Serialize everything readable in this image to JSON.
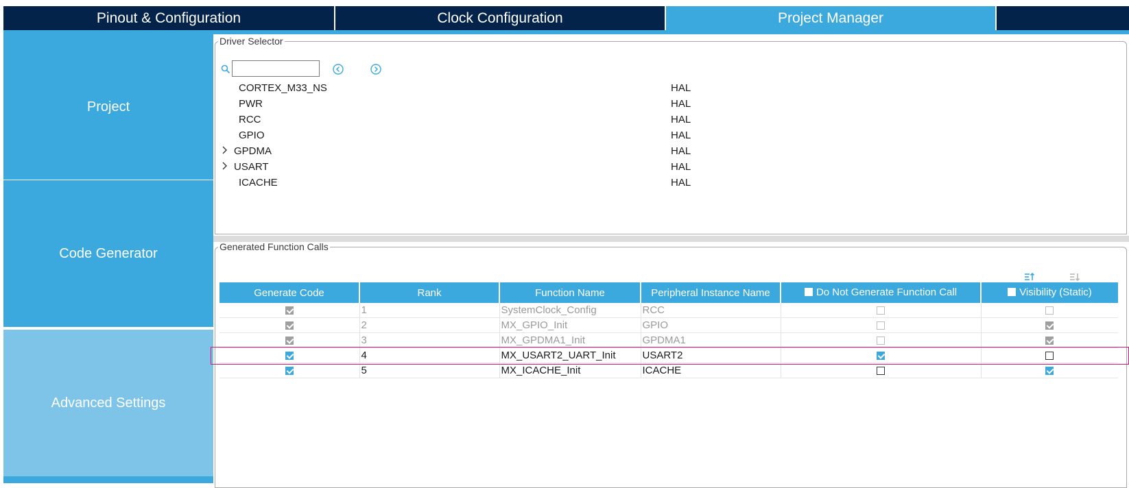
{
  "tabs": [
    {
      "label": "Pinout & Configuration",
      "active": false
    },
    {
      "label": "Clock Configuration",
      "active": false
    },
    {
      "label": "Project Manager",
      "active": true
    },
    {
      "label": "",
      "active": false
    }
  ],
  "sidebar": {
    "items": [
      {
        "label": "Project"
      },
      {
        "label": "Code Generator"
      },
      {
        "label": "Advanced Settings"
      }
    ]
  },
  "driver_selector": {
    "legend": "Driver Selector",
    "search_value": "",
    "rows": [
      {
        "name": "CORTEX_M33_NS",
        "library": "HAL",
        "expandable": false
      },
      {
        "name": "PWR",
        "library": "HAL",
        "expandable": false
      },
      {
        "name": "RCC",
        "library": "HAL",
        "expandable": false
      },
      {
        "name": "GPIO",
        "library": "HAL",
        "expandable": false
      },
      {
        "name": "GPDMA",
        "library": "HAL",
        "expandable": true
      },
      {
        "name": "USART",
        "library": "HAL",
        "expandable": true
      },
      {
        "name": "ICACHE",
        "library": "HAL",
        "expandable": false
      }
    ]
  },
  "generated_calls": {
    "legend": "Generated Function Calls",
    "headers": {
      "generate_code": "Generate Code",
      "rank": "Rank",
      "function_name": "Function Name",
      "peripheral_instance": "Peripheral Instance Name",
      "do_not_generate": "Do Not Generate Function Call",
      "visibility": "Visibility (Static)"
    },
    "rows": [
      {
        "rank": "1",
        "function": "SystemClock_Config",
        "instance": "RCC",
        "generate": true,
        "do_not_generate": false,
        "visibility": false,
        "enabled": false
      },
      {
        "rank": "2",
        "function": "MX_GPIO_Init",
        "instance": "GPIO",
        "generate": true,
        "do_not_generate": false,
        "visibility": true,
        "enabled": false
      },
      {
        "rank": "3",
        "function": "MX_GPDMA1_Init",
        "instance": "GPDMA1",
        "generate": true,
        "do_not_generate": false,
        "visibility": true,
        "enabled": false
      },
      {
        "rank": "4",
        "function": "MX_USART2_UART_Init",
        "instance": "USART2",
        "generate": true,
        "do_not_generate": true,
        "visibility": false,
        "enabled": true,
        "highlighted": true
      },
      {
        "rank": "5",
        "function": "MX_ICACHE_Init",
        "instance": "ICACHE",
        "generate": true,
        "do_not_generate": false,
        "visibility": true,
        "enabled": true
      }
    ]
  },
  "colors": {
    "tab_dark": "#03234b",
    "accent": "#3ba9dd",
    "nav_light": "#7ec4e8",
    "highlight": "#d4157a"
  }
}
